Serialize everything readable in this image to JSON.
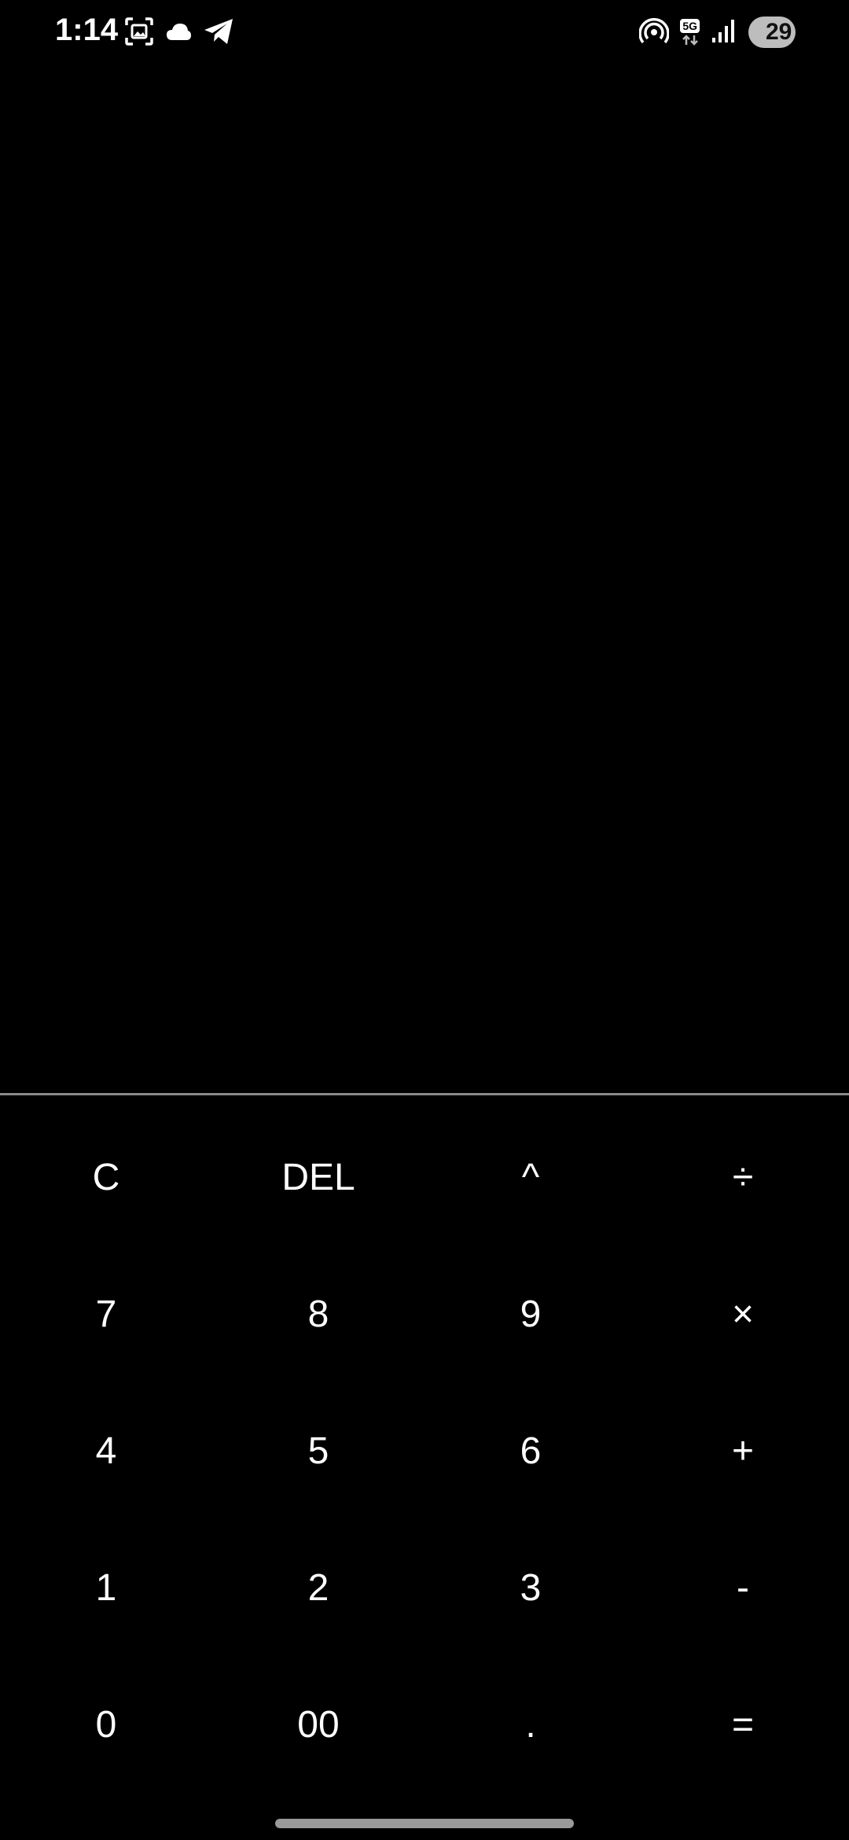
{
  "status_bar": {
    "time": "1:14",
    "left_icons": [
      "screenshot-icon",
      "cloud-icon",
      "telegram-icon"
    ],
    "right_icons": [
      "hotspot-icon",
      "network-5g-icon",
      "signal-icon",
      "battery-icon"
    ],
    "network_label": "5G",
    "battery_level": "29"
  },
  "display": {
    "expression": "",
    "result": ""
  },
  "keypad": {
    "rows": [
      [
        "C",
        "DEL",
        "^",
        "÷"
      ],
      [
        "7",
        "8",
        "9",
        "×"
      ],
      [
        "4",
        "5",
        "6",
        "+"
      ],
      [
        "1",
        "2",
        "3",
        "-"
      ],
      [
        "0",
        "00",
        ".",
        "="
      ]
    ]
  },
  "colors": {
    "background": "#000000",
    "text": "#ffffff",
    "divider": "#8a8a8a"
  }
}
